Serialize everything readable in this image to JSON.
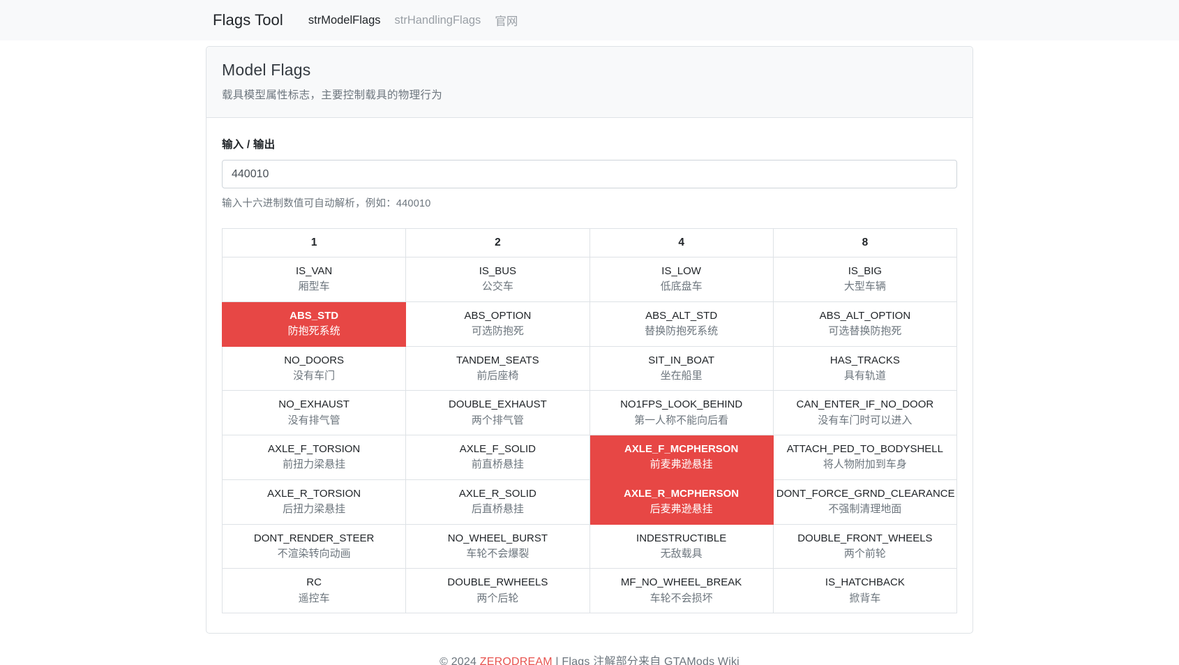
{
  "navbar": {
    "brand": "Flags Tool",
    "links": [
      {
        "label": "strModelFlags",
        "active": true
      },
      {
        "label": "strHandlingFlags",
        "active": false
      },
      {
        "label": "官网",
        "active": false
      }
    ]
  },
  "card": {
    "title": "Model Flags",
    "subtitle": "载具模型属性标志，主要控制载具的物理行为",
    "input": {
      "label": "输入 / 输出",
      "value": "440010",
      "placeholder": "",
      "help": "输入十六进制数值可自动解析，例如：440010"
    }
  },
  "table": {
    "headers": [
      "1",
      "2",
      "4",
      "8"
    ],
    "rows": [
      [
        {
          "name": "IS_VAN",
          "desc": "厢型车",
          "active": false
        },
        {
          "name": "IS_BUS",
          "desc": "公交车",
          "active": false
        },
        {
          "name": "IS_LOW",
          "desc": "低底盘车",
          "active": false
        },
        {
          "name": "IS_BIG",
          "desc": "大型车辆",
          "active": false
        }
      ],
      [
        {
          "name": "ABS_STD",
          "desc": "防抱死系统",
          "active": true
        },
        {
          "name": "ABS_OPTION",
          "desc": "可选防抱死",
          "active": false
        },
        {
          "name": "ABS_ALT_STD",
          "desc": "替换防抱死系统",
          "active": false
        },
        {
          "name": "ABS_ALT_OPTION",
          "desc": "可选替换防抱死",
          "active": false
        }
      ],
      [
        {
          "name": "NO_DOORS",
          "desc": "没有车门",
          "active": false
        },
        {
          "name": "TANDEM_SEATS",
          "desc": "前后座椅",
          "active": false
        },
        {
          "name": "SIT_IN_BOAT",
          "desc": "坐在船里",
          "active": false
        },
        {
          "name": "HAS_TRACKS",
          "desc": "具有轨道",
          "active": false
        }
      ],
      [
        {
          "name": "NO_EXHAUST",
          "desc": "没有排气管",
          "active": false
        },
        {
          "name": "DOUBLE_EXHAUST",
          "desc": "两个排气管",
          "active": false
        },
        {
          "name": "NO1FPS_LOOK_BEHIND",
          "desc": "第一人称不能向后看",
          "active": false
        },
        {
          "name": "CAN_ENTER_IF_NO_DOOR",
          "desc": "没有车门时可以进入",
          "active": false
        }
      ],
      [
        {
          "name": "AXLE_F_TORSION",
          "desc": "前扭力梁悬挂",
          "active": false
        },
        {
          "name": "AXLE_F_SOLID",
          "desc": "前直桥悬挂",
          "active": false
        },
        {
          "name": "AXLE_F_MCPHERSON",
          "desc": "前麦弗逊悬挂",
          "active": true
        },
        {
          "name": "ATTACH_PED_TO_BODYSHELL",
          "desc": "将人物附加到车身",
          "active": false
        }
      ],
      [
        {
          "name": "AXLE_R_TORSION",
          "desc": "后扭力梁悬挂",
          "active": false
        },
        {
          "name": "AXLE_R_SOLID",
          "desc": "后直桥悬挂",
          "active": false
        },
        {
          "name": "AXLE_R_MCPHERSON",
          "desc": "后麦弗逊悬挂",
          "active": true
        },
        {
          "name": "DONT_FORCE_GRND_CLEARANCE",
          "desc": "不强制清理地面",
          "active": false
        }
      ],
      [
        {
          "name": "DONT_RENDER_STEER",
          "desc": "不渲染转向动画",
          "active": false
        },
        {
          "name": "NO_WHEEL_BURST",
          "desc": "车轮不会爆裂",
          "active": false
        },
        {
          "name": "INDESTRUCTIBLE",
          "desc": "无敌载具",
          "active": false
        },
        {
          "name": "DOUBLE_FRONT_WHEELS",
          "desc": "两个前轮",
          "active": false
        }
      ],
      [
        {
          "name": "RC",
          "desc": "遥控车",
          "active": false
        },
        {
          "name": "DOUBLE_RWHEELS",
          "desc": "两个后轮",
          "active": false
        },
        {
          "name": "MF_NO_WHEEL_BREAK",
          "desc": "车轮不会损坏",
          "active": false
        },
        {
          "name": "IS_HATCHBACK",
          "desc": "掀背车",
          "active": false
        }
      ]
    ]
  },
  "footer": {
    "prefix": "© 2024 ",
    "accent": "ZERODREAM",
    "suffix": " | Flags 注解部分来自 GTAMods Wiki"
  },
  "colors": {
    "active_bg": "#e74745",
    "accent": "#e8534f",
    "header_bg": "#f8f9fa",
    "border": "#dee2e6"
  }
}
